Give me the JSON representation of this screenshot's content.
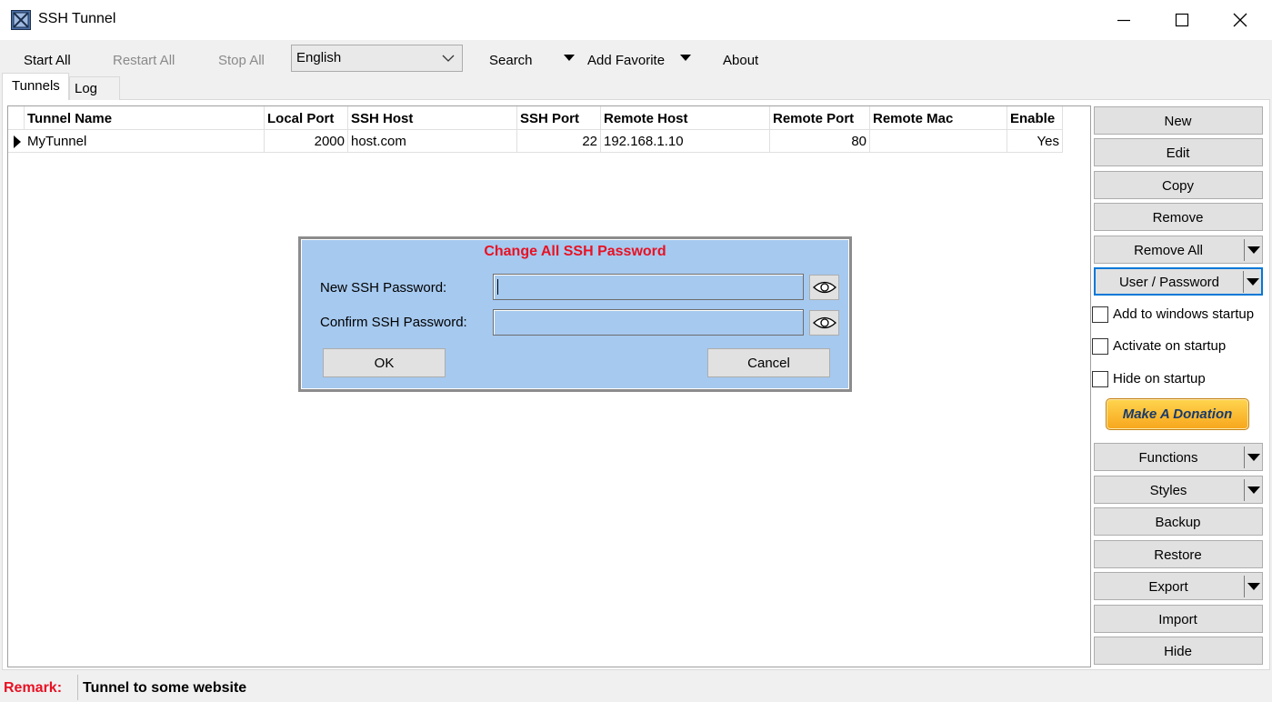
{
  "window": {
    "title": "SSH Tunnel",
    "icon": "app-icon",
    "controls": [
      "minimize-icon",
      "maximize-icon",
      "close-icon"
    ]
  },
  "toolbar": {
    "start_all": "Start All",
    "restart_all": "Restart All",
    "stop_all": "Stop All",
    "language": "English",
    "search": "Search",
    "add_favorite": "Add Favorite",
    "about": "About"
  },
  "tabs": [
    {
      "label": "Tunnels",
      "active": true
    },
    {
      "label": "Log",
      "active": false
    }
  ],
  "table": {
    "columns": [
      "Tunnel Name",
      "Local Port",
      "SSH Host",
      "SSH Port",
      "Remote Host",
      "Remote Port",
      "Remote Mac",
      "Enable"
    ],
    "rows": [
      [
        "MyTunnel",
        "2000",
        "host.com",
        "22",
        "192.168.1.10",
        "80",
        "",
        "Yes"
      ]
    ]
  },
  "dialog": {
    "title": "Change All SSH Password",
    "new_password_label": "New SSH Password:",
    "confirm_password_label": "Confirm SSH Password:",
    "new_password_value": "",
    "confirm_password_value": "",
    "ok": "OK",
    "cancel": "Cancel"
  },
  "side": {
    "new": "New",
    "edit": "Edit",
    "copy": "Copy",
    "remove": "Remove",
    "remove_all": "Remove All",
    "user_password": "User / Password",
    "add_startup": "Add to windows startup",
    "activate_startup": "Activate on startup",
    "hide_startup": "Hide on startup",
    "donate": "Make A Donation",
    "functions": "Functions",
    "styles": "Styles",
    "backup": "Backup",
    "restore": "Restore",
    "export": "Export",
    "import": "Import",
    "hide": "Hide"
  },
  "status": {
    "label": "Remark:",
    "value": "Tunnel to some website"
  },
  "colors": {
    "dialog_bg": "#a6c9ef",
    "accent_red": "#e81123",
    "focus_blue": "#0078d7"
  }
}
